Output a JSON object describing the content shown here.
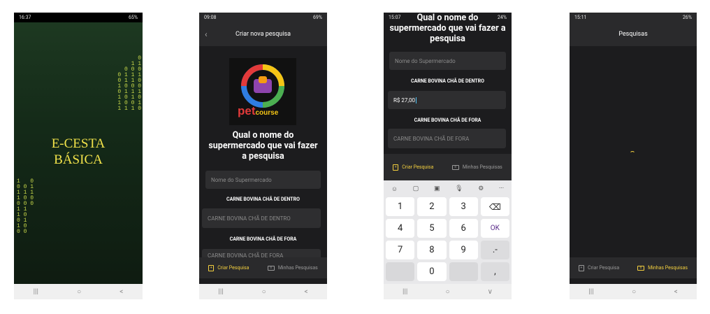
{
  "screen1": {
    "status_time": "16:37",
    "status_right": "65%",
    "title_line1": "E-CESTA",
    "title_line2": "BÁSICA",
    "binary_right": "0\n1 1\n0 0 0\n0 1 1 1\n0 1 1 0\n1 0 0 0\n0 1 1 1\n1 0 1 0\n1 0 0 1\n1 1 1 0",
    "binary_left": "1   0\n0 0 1\n1 1 1\n1 0 0\n0 0 0\n1 1\n1 0\n0 1\n1 0\n0 0"
  },
  "screen2": {
    "status_time": "09:08",
    "status_right": "69%",
    "appbar_title": "Criar nova pesquisa",
    "logo_text_pet": "pet",
    "logo_text_course": "course",
    "question": "Qual o nome do supermercado que vai fazer a pesquisa",
    "supermarket_placeholder": "Nome do Supermercado",
    "product1_label": "CARNE BOVINA CHÃ DE DENTRO",
    "product1_placeholder": "CARNE BOVINA CHÃ DE DENTRO",
    "product2_label": "CARNE BOVINA CHÃ DE FORA",
    "product2_placeholder": "CARNE BOVINA CHÃ DE FORA",
    "tab_create": "Criar Pesquisa",
    "tab_mine": "Minhas Pesquisas"
  },
  "screen3": {
    "status_time": "15:07",
    "status_right": "24%",
    "question": "Qual o nome do supermercado que vai fazer a pesquisa",
    "supermarket_placeholder": "Nome do Supermercado",
    "product1_label": "CARNE BOVINA CHÃ DE DENTRO",
    "product1_value": "R$ 27,00",
    "product2_label": "CARNE BOVINA CHÃ DE FORA",
    "product2_placeholder": "CARNE BOVINA CHÃ DE FORA",
    "tab_create": "Criar Pesquisa",
    "tab_mine": "Minhas Pesquisas",
    "keys": [
      "1",
      "2",
      "3",
      "⌫",
      "4",
      "5",
      "6",
      "OK",
      "7",
      "8",
      "9",
      ".-",
      "",
      "0",
      "",
      ","
    ],
    "toolbar_more": "···"
  },
  "screen4": {
    "status_time": "15:11",
    "status_right": "26%",
    "appbar_title": "Pesquisas",
    "tab_create": "Criar Pesquisa",
    "tab_mine": "Minhas Pesquisas"
  },
  "navbar": {
    "recents": "|||",
    "home": "○",
    "back": "<"
  }
}
